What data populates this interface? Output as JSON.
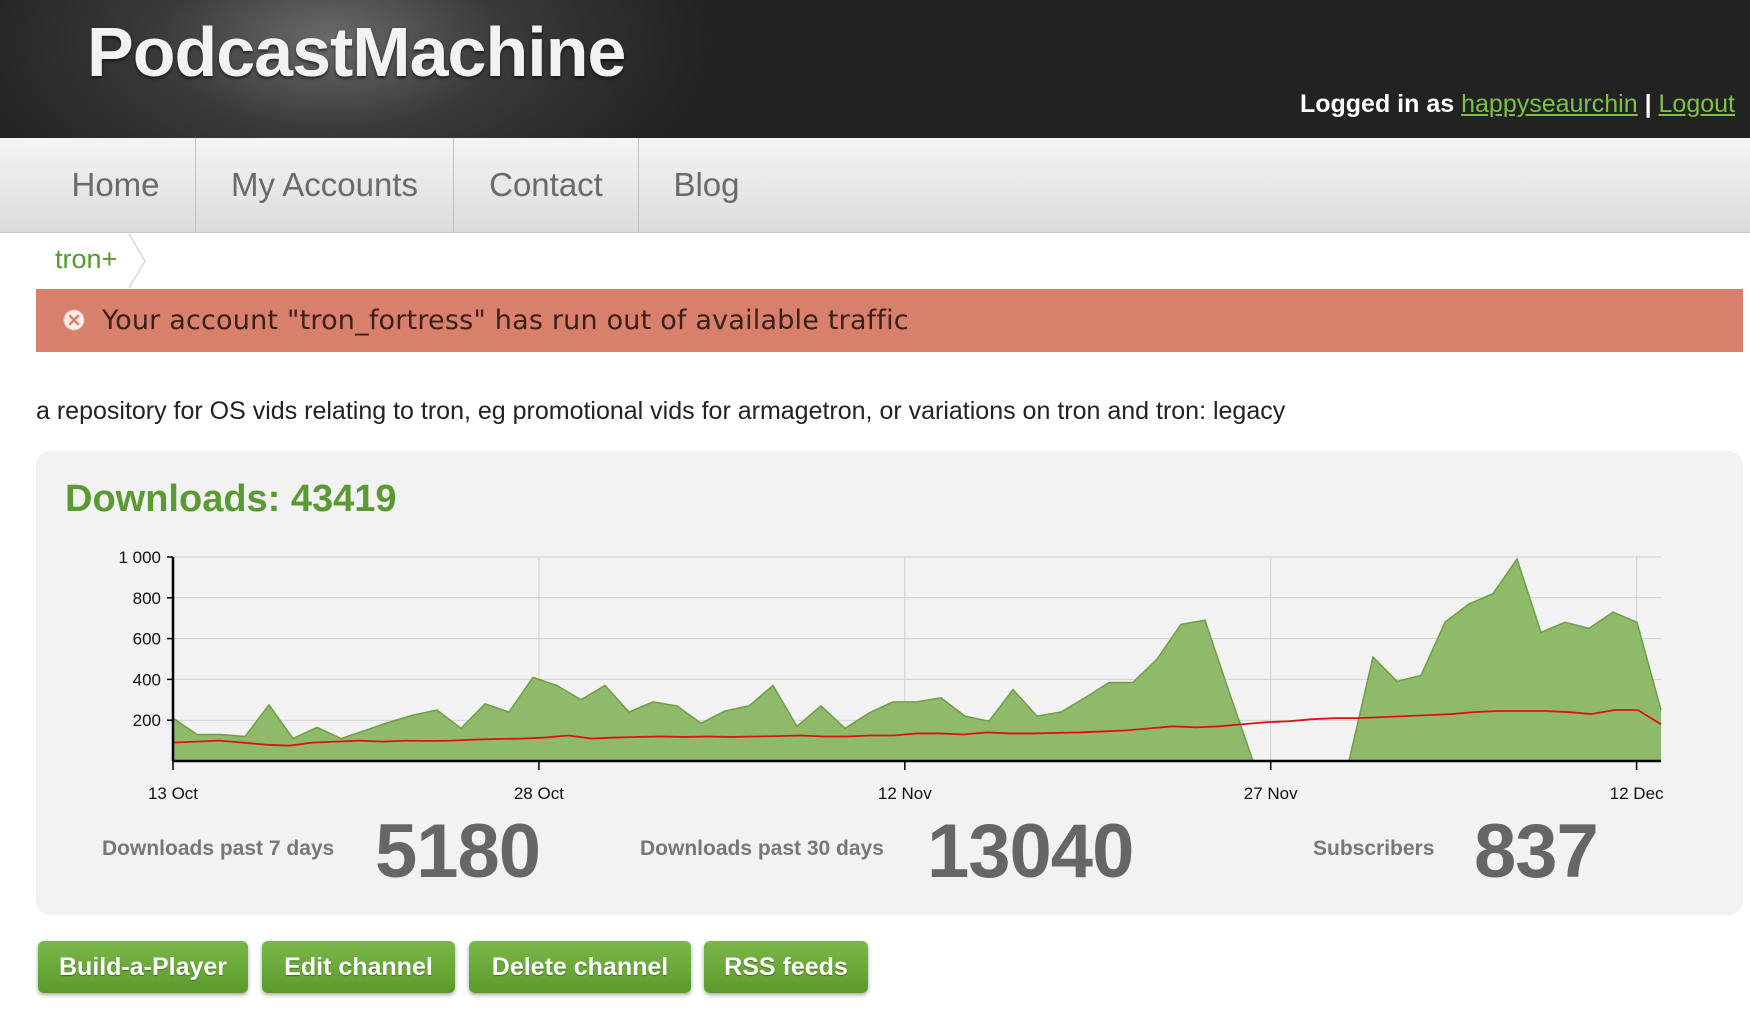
{
  "header": {
    "logo": "PodcastMachine",
    "logged_in_prefix": "Logged in as",
    "username": "happyseaurchin",
    "separator": "|",
    "logout": "Logout"
  },
  "nav": {
    "items": [
      {
        "label": "Home"
      },
      {
        "label": "My Accounts"
      },
      {
        "label": "Contact"
      },
      {
        "label": "Blog"
      }
    ]
  },
  "breadcrumb": {
    "label": "tron+"
  },
  "alert": {
    "icon": "close-circle-icon",
    "text": "Your account \"tron_fortress\" has run out of available traffic",
    "color": "#d8806c"
  },
  "description": "a repository for OS vids relating to tron, eg promotional vids for armagetron, or variations on tron and tron: legacy",
  "downloads": {
    "title": "Downloads: 43419"
  },
  "stats": {
    "past7_label": "Downloads past 7 days",
    "past7_value": "5180",
    "past30_label": "Downloads past 30 days",
    "past30_value": "13040",
    "subscribers_label": "Subscribers",
    "subscribers_value": "837"
  },
  "buttons": {
    "build_player": "Build-a-Player",
    "edit_channel": "Edit channel",
    "delete_channel": "Delete channel",
    "rss_feeds": "RSS feeds"
  },
  "chart_data": {
    "type": "area",
    "ylim": [
      0,
      1000
    ],
    "y_ticks": [
      200,
      400,
      600,
      800,
      1000
    ],
    "y_tick_labels": [
      "200",
      "400",
      "600",
      "800",
      "1 000"
    ],
    "x_tick_labels": [
      "13 Oct",
      "28 Oct",
      "12 Nov",
      "27 Nov",
      "12 Dec"
    ],
    "x_tick_days": [
      0,
      15,
      30,
      45,
      60
    ],
    "x_max_day": 61,
    "grid": true,
    "colors": {
      "area_fill": "#8fba6a",
      "area_stroke": "#6f9e45",
      "trend_line": "#e01010"
    },
    "series": [
      {
        "values": [
          210,
          130,
          130,
          120,
          275,
          110,
          165,
          110,
          150,
          190,
          225,
          250,
          160,
          280,
          240,
          410,
          370,
          300,
          370,
          240,
          290,
          270,
          185,
          245,
          270,
          370,
          170,
          270,
          160,
          235,
          290,
          290,
          310,
          220,
          195,
          350,
          220,
          240,
          310,
          385,
          385,
          500,
          670,
          690,
          340,
          0,
          0,
          0,
          0,
          0,
          510,
          390,
          420,
          680,
          770,
          820,
          990,
          630,
          680,
          650,
          730,
          680,
          250
        ]
      },
      {
        "values": [
          90,
          95,
          100,
          90,
          80,
          75,
          90,
          95,
          100,
          95,
          100,
          98,
          100,
          105,
          108,
          110,
          115,
          125,
          110,
          115,
          118,
          120,
          118,
          120,
          118,
          120,
          122,
          125,
          120,
          120,
          125,
          125,
          135,
          135,
          130,
          140,
          135,
          135,
          138,
          140,
          145,
          150,
          160,
          170,
          165,
          170,
          180,
          190,
          195,
          205,
          210,
          210,
          215,
          220,
          225,
          230,
          240,
          245,
          245,
          245,
          240,
          230,
          250,
          250,
          180
        ]
      }
    ]
  }
}
